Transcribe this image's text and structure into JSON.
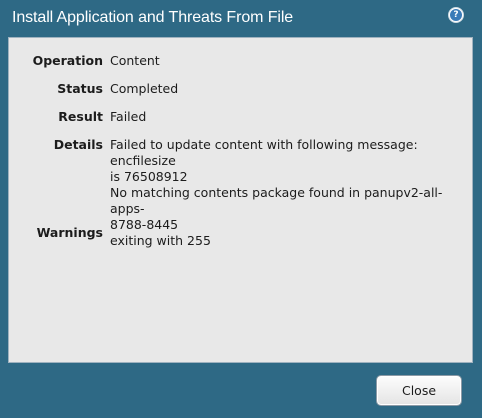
{
  "dialog": {
    "title": "Install Application and Threats From File",
    "help_icon": "question-mark-icon",
    "help_glyph": "?",
    "fields": [
      {
        "label": "Operation",
        "value": "Content"
      },
      {
        "label": "Status",
        "value": "Completed"
      },
      {
        "label": "Result",
        "value": "Failed"
      },
      {
        "label": "Details",
        "value": "Failed to update content with following message: encfilesize\nis 76508912\nNo matching contents package found in panupv2-all-apps-\n8788-8445\nexiting with 255"
      },
      {
        "label": "Warnings",
        "value": ""
      }
    ],
    "close_label": "Close"
  },
  "colors": {
    "frame": "#2e6985",
    "panel": "#e8e8e8",
    "help_icon": "#3a7bb8"
  }
}
